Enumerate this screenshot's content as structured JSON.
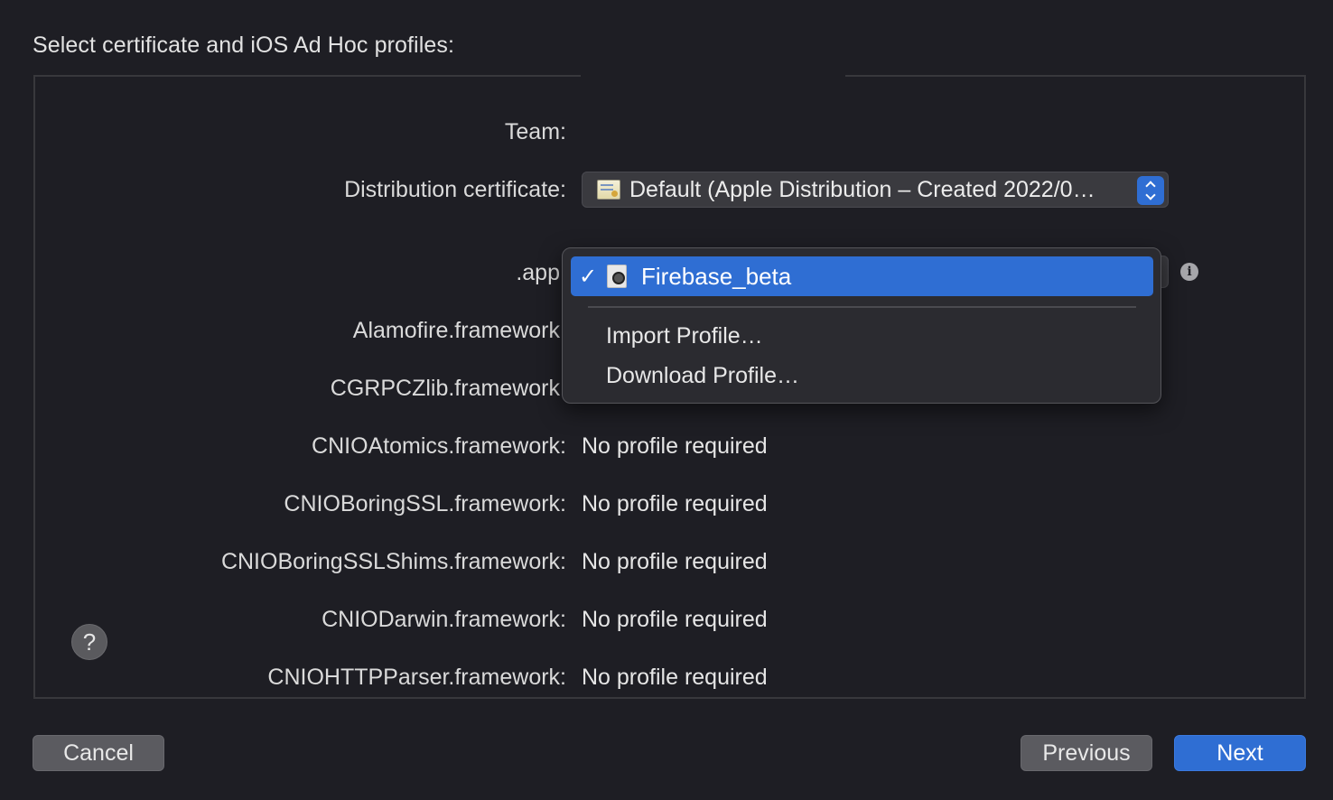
{
  "dialog": {
    "title": "Select certificate and iOS Ad Hoc profiles:"
  },
  "form": {
    "team_label": "Team:",
    "distribution_certificate_label": "Distribution certificate:",
    "distribution_certificate_value": "Default (Apple Distribution – Created 2022/0…",
    "rows": [
      {
        "label": ".app",
        "value": ""
      },
      {
        "label": "Alamofire.framework",
        "value": ""
      },
      {
        "label": "CGRPCZlib.framework",
        "value": ""
      },
      {
        "label": "CNIOAtomics.framework:",
        "value": "No profile required"
      },
      {
        "label": "CNIOBoringSSL.framework:",
        "value": "No profile required"
      },
      {
        "label": "CNIOBoringSSLShims.framework:",
        "value": "No profile required"
      },
      {
        "label": "CNIODarwin.framework:",
        "value": "No profile required"
      },
      {
        "label": "CNIOHTTPParser.framework:",
        "value": "No profile required"
      }
    ]
  },
  "profile_menu": {
    "selected_check": "✓",
    "selected_item": "Firebase_beta",
    "items": [
      "Import Profile…",
      "Download Profile…"
    ]
  },
  "help": {
    "label": "?"
  },
  "info": {
    "label": "i"
  },
  "buttons": {
    "cancel": "Cancel",
    "previous": "Previous",
    "next": "Next"
  },
  "colors": {
    "accent": "#2f6ed3",
    "background": "#1e1e24"
  }
}
